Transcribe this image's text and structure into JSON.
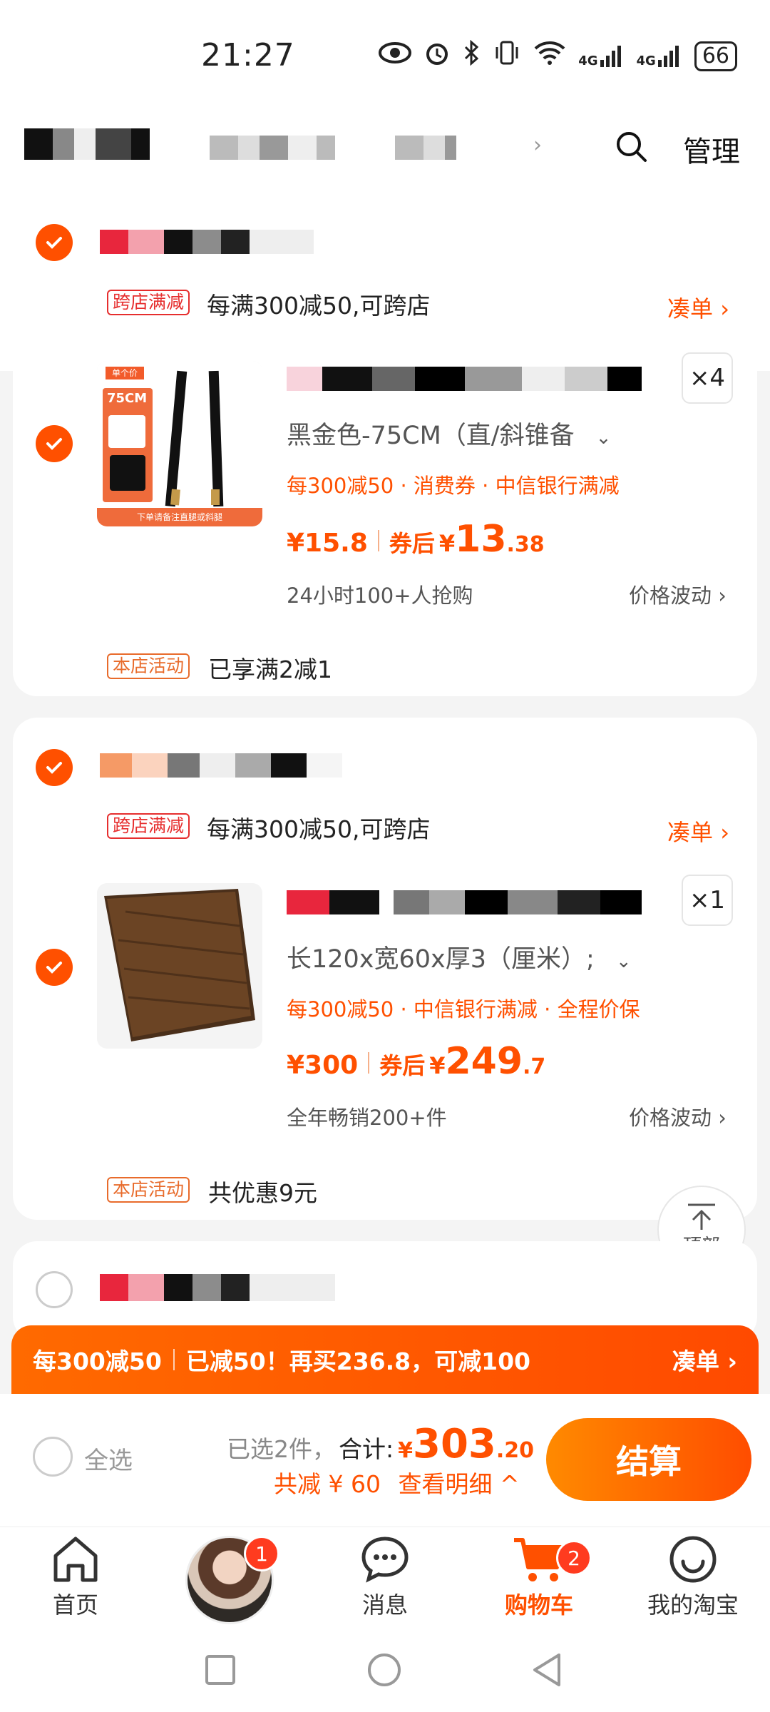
{
  "status_bar": {
    "time": "21:27",
    "battery": "66",
    "net1": "4G",
    "net2": "4G"
  },
  "header": {
    "manage_label": "管理"
  },
  "shops": [
    {
      "promo_tag": "跨店满减",
      "promo_text": "每满300减50,可跨店",
      "promo_link": "凑单",
      "item": {
        "qty": "×4",
        "sku": "黑金色-75CM（直/斜锥备",
        "promos": "每300减50 · 消费券 · 中信银行满减",
        "price": "¥15.8",
        "after_label": "券后",
        "after_symbol": "¥",
        "after_int": "13",
        "after_dec": ".38",
        "sales": "24小时100+人抢购",
        "fluct": "价格波动",
        "thumb_label_top": "单个价",
        "thumb_label_size": "75CM",
        "thumb_caption": "下单请备注直腿或斜腿"
      },
      "store_tag": "本店活动",
      "store_text": "已享满2减1"
    },
    {
      "promo_tag": "跨店满减",
      "promo_text": "每满300减50,可跨店",
      "promo_link": "凑单",
      "item": {
        "qty": "×1",
        "sku": "长120x宽60x厚3（厘米）;",
        "promos": "每300减50 · 中信银行满减 · 全程价保",
        "price": "¥300",
        "after_label": "券后",
        "after_symbol": "¥",
        "after_int": "249",
        "after_dec": ".7",
        "sales": "全年畅销200+件",
        "fluct": "价格波动"
      },
      "store_tag": "本店活动",
      "store_text": "共优惠9元"
    }
  ],
  "to_top": "顶部",
  "promo_bar": {
    "left": "每300减50",
    "middle": "已减50！再买236.8，可减100",
    "link": "凑单"
  },
  "checkout": {
    "select_all": "全选",
    "selected": "已选2件，",
    "total_label": "合计:",
    "total_symbol": "¥",
    "total_int": "303",
    "total_dec": ".20",
    "discount": "共减 ¥ 60",
    "detail": "查看明细",
    "button": "结算"
  },
  "tabs": [
    {
      "label": "首页"
    },
    {
      "label": "",
      "badge": "1"
    },
    {
      "label": "消息"
    },
    {
      "label": "购物车",
      "badge": "2"
    },
    {
      "label": "我的淘宝"
    }
  ],
  "colors": {
    "accent": "#ff5000",
    "brand_orange": "#ff6a00"
  }
}
